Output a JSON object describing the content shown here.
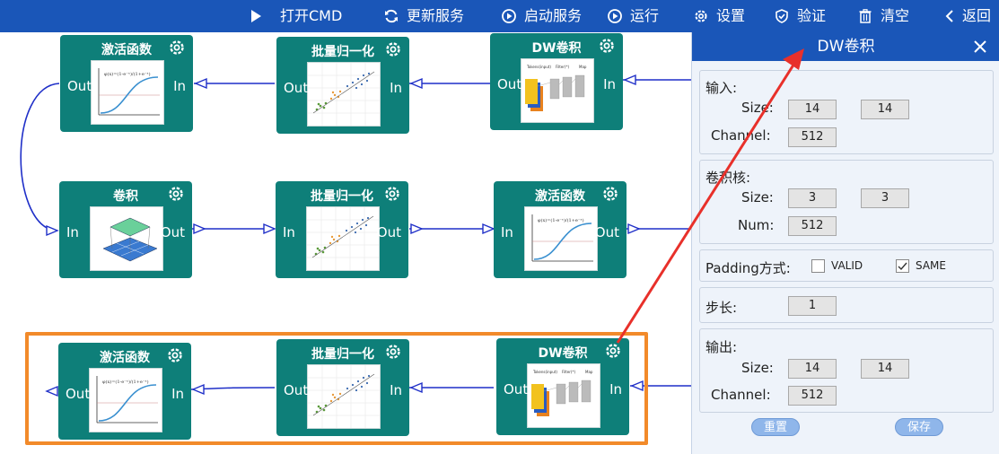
{
  "toolbar": {
    "open_cmd": "打开CMD",
    "update_service": "更新服务",
    "start_service": "启动服务",
    "run": "运行",
    "settings": "设置",
    "verify": "验证",
    "clear": "清空",
    "back": "返回"
  },
  "nodes": [
    {
      "title": "激活函数",
      "left_port": "Out",
      "right_port": "In",
      "thumb": "sigmoid"
    },
    {
      "title": "批量归一化",
      "left_port": "Out",
      "right_port": "In",
      "thumb": "scatter"
    },
    {
      "title": "DW卷积",
      "left_port": "Out",
      "right_port": "In",
      "thumb": "dwconv"
    },
    {
      "title": "卷积",
      "left_port": "In",
      "right_port": "Out",
      "thumb": "conv"
    },
    {
      "title": "批量归一化",
      "left_port": "In",
      "right_port": "Out",
      "thumb": "scatter"
    },
    {
      "title": "激活函数",
      "left_port": "In",
      "right_port": "Out",
      "thumb": "sigmoid"
    },
    {
      "title": "激活函数",
      "left_port": "Out",
      "right_port": "In",
      "thumb": "sigmoid"
    },
    {
      "title": "批量归一化",
      "left_port": "Out",
      "right_port": "In",
      "thumb": "scatter"
    },
    {
      "title": "DW卷积",
      "left_port": "Out",
      "right_port": "In",
      "thumb": "dwconv"
    }
  ],
  "panel": {
    "title": "DW卷积",
    "input": {
      "heading": "输入:",
      "size_label": "Size:",
      "size": [
        "14",
        "14"
      ],
      "channel_label": "Channel:",
      "channel": "512"
    },
    "kernel": {
      "heading": "卷积核:",
      "size_label": "Size:",
      "size": [
        "3",
        "3"
      ],
      "num_label": "Num:",
      "num": "512"
    },
    "padding": {
      "label": "Padding方式:",
      "options": [
        {
          "label": "VALID",
          "checked": false
        },
        {
          "label": "SAME",
          "checked": true
        }
      ]
    },
    "stride": {
      "label": "步长:",
      "value": "1"
    },
    "output": {
      "heading": "输出:",
      "size_label": "Size:",
      "size": [
        "14",
        "14"
      ],
      "channel_label": "Channel:",
      "channel": "512"
    },
    "reset_label": "重置",
    "save_label": "保存"
  },
  "colors": {
    "toolbar_bg": "#1a56b8",
    "node_bg": "#0e7f79",
    "selection": "#f28a2a",
    "wire": "#1f2fc8",
    "annotation_arrow": "#e8302a"
  }
}
